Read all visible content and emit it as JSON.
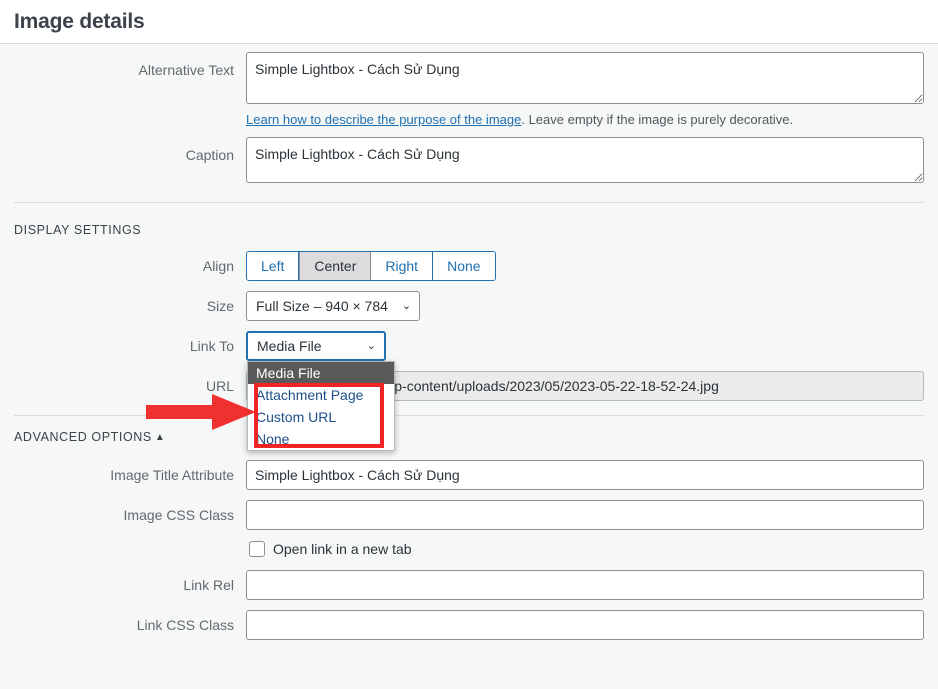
{
  "header": {
    "title": "Image details"
  },
  "fields": {
    "alt_text": {
      "label": "Alternative Text",
      "value": "Simple Lightbox - Cách Sử Dụng",
      "help_link": "Learn how to describe the purpose of the image",
      "help_rest": ". Leave empty if the image is purely decorative."
    },
    "caption": {
      "label": "Caption",
      "value": "Simple Lightbox - Cách Sử Dụng"
    }
  },
  "display_settings": {
    "heading": "Display settings",
    "align": {
      "label": "Align",
      "options": [
        "Left",
        "Center",
        "Right",
        "None"
      ],
      "selected": "Center"
    },
    "size": {
      "label": "Size",
      "selected": "Full Size – 940 × 784",
      "caret": "⌄"
    },
    "link_to": {
      "label": "Link To",
      "selected": "Media File",
      "caret": "⌄",
      "expanded": true,
      "options": [
        "Media File",
        "Attachment Page",
        "Custom URL",
        "None"
      ],
      "highlighted": "Media File"
    },
    "url": {
      "label": "URL",
      "value": "https://example.com/wp-content/uploads/2023/05/2023-05-22-18-52-24.jpg",
      "visible_tail": "ontent/uploads/2023/05/2023-05-22-18-52-24.jpg",
      "disabled": true
    }
  },
  "advanced_options": {
    "heading": "Advanced options",
    "toggle_caret": "▲",
    "image_title": {
      "label": "Image Title Attribute",
      "value": "Simple Lightbox - Cách Sử Dụng"
    },
    "image_css_class": {
      "label": "Image CSS Class",
      "value": ""
    },
    "open_new_tab": {
      "label": "Open link in a new tab",
      "checked": false
    },
    "link_rel": {
      "label": "Link Rel",
      "value": ""
    },
    "link_css_class": {
      "label": "Link CSS Class",
      "value": ""
    }
  },
  "annotations": {
    "arrow_color": "#f0312f",
    "box_color": "#f02424"
  }
}
